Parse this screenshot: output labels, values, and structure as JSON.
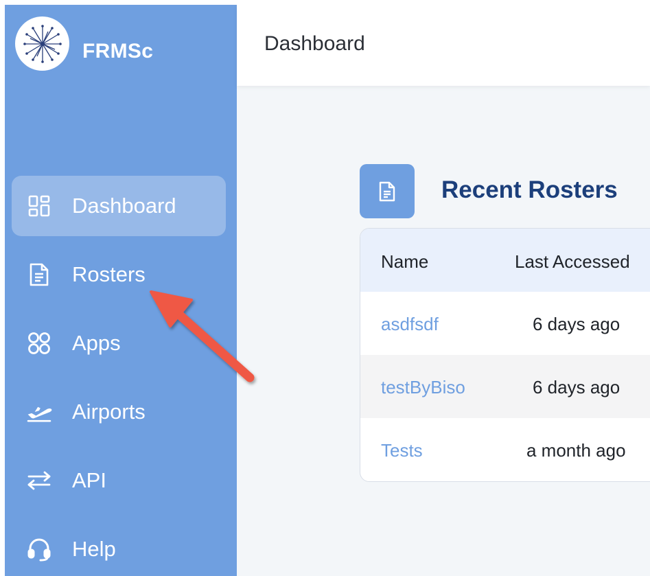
{
  "brand": {
    "name": "FRMSc"
  },
  "sidebar": {
    "items": [
      {
        "label": "Dashboard",
        "icon": "dashboard-grid-icon",
        "active": true
      },
      {
        "label": "Rosters",
        "icon": "document-icon"
      },
      {
        "label": "Apps",
        "icon": "apps-icon"
      },
      {
        "label": "Airports",
        "icon": "airplane-takeoff-icon"
      },
      {
        "label": "API",
        "icon": "transfer-arrows-icon"
      },
      {
        "label": "Help",
        "icon": "headset-icon"
      }
    ]
  },
  "header": {
    "title": "Dashboard"
  },
  "recent_rosters": {
    "title": "Recent Rosters",
    "icon": "document-icon",
    "columns": [
      "Name",
      "Last Accessed"
    ],
    "rows": [
      {
        "name": "asdfsdf",
        "last_accessed": "6 days ago"
      },
      {
        "name": "testByBiso",
        "last_accessed": "6 days ago"
      },
      {
        "name": "Tests",
        "last_accessed": "a month ago"
      }
    ]
  },
  "colors": {
    "sidebar": "#6f9fe0",
    "title": "#1c3f7b",
    "link": "#6f9fe0",
    "annotation_arrow": "#ef5944"
  }
}
